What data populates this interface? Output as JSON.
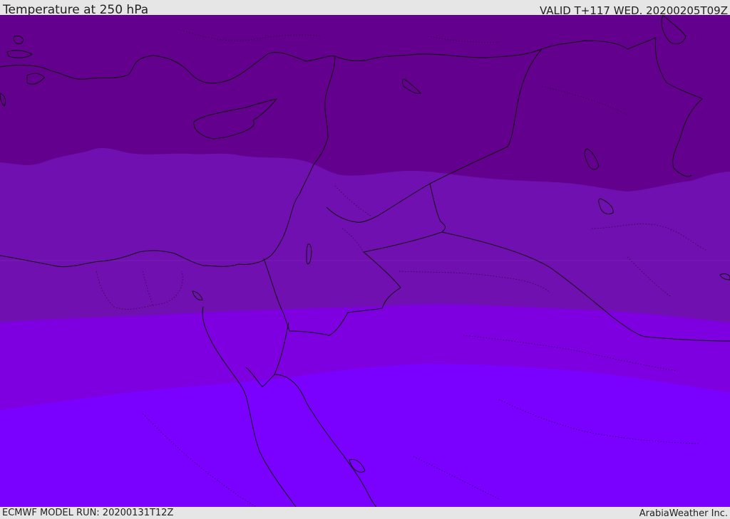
{
  "header": {
    "title": "Temperature at 250 hPa",
    "valid": "VALID T+117 WED. 20200205T09Z"
  },
  "footer": {
    "model_run": "ECMWF MODEL RUN: 20200131T12Z",
    "credit": "ArabiaWeather Inc."
  },
  "map": {
    "temperature_band_colors": [
      "#64008e",
      "#7010b0",
      "#7e00e0",
      "#7a00ff"
    ],
    "coastline_color": "#111111",
    "border_style": "dotted"
  }
}
